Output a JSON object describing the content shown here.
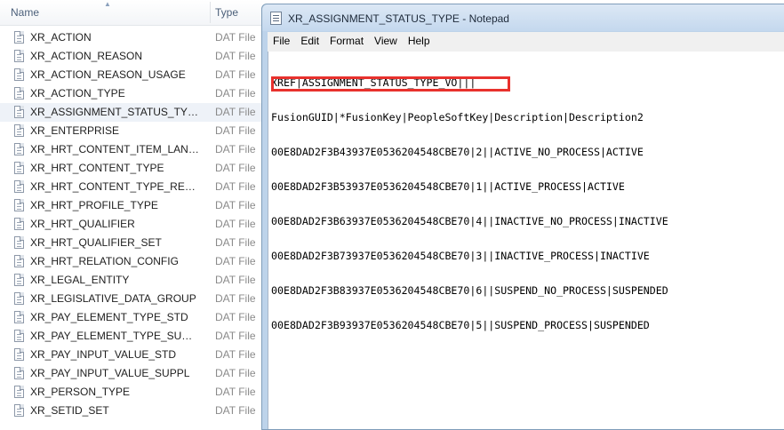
{
  "explorer": {
    "columns": {
      "name": "Name",
      "type": "Type"
    },
    "files": [
      {
        "name": "XR_ACTION",
        "type": "DAT File"
      },
      {
        "name": "XR_ACTION_REASON",
        "type": "DAT File"
      },
      {
        "name": "XR_ACTION_REASON_USAGE",
        "type": "DAT File"
      },
      {
        "name": "XR_ACTION_TYPE",
        "type": "DAT File"
      },
      {
        "name": "XR_ASSIGNMENT_STATUS_TYPE",
        "type": "DAT File",
        "selected": true
      },
      {
        "name": "XR_ENTERPRISE",
        "type": "DAT File"
      },
      {
        "name": "XR_HRT_CONTENT_ITEM_LANGU...",
        "type": "DAT File"
      },
      {
        "name": "XR_HRT_CONTENT_TYPE",
        "type": "DAT File"
      },
      {
        "name": "XR_HRT_CONTENT_TYPE_RELAT",
        "type": "DAT File"
      },
      {
        "name": "XR_HRT_PROFILE_TYPE",
        "type": "DAT File"
      },
      {
        "name": "XR_HRT_QUALIFIER",
        "type": "DAT File"
      },
      {
        "name": "XR_HRT_QUALIFIER_SET",
        "type": "DAT File"
      },
      {
        "name": "XR_HRT_RELATION_CONFIG",
        "type": "DAT File"
      },
      {
        "name": "XR_LEGAL_ENTITY",
        "type": "DAT File"
      },
      {
        "name": "XR_LEGISLATIVE_DATA_GROUP",
        "type": "DAT File"
      },
      {
        "name": "XR_PAY_ELEMENT_TYPE_STD",
        "type": "DAT File"
      },
      {
        "name": "XR_PAY_ELEMENT_TYPE_SUPPL",
        "type": "DAT File"
      },
      {
        "name": "XR_PAY_INPUT_VALUE_STD",
        "type": "DAT File"
      },
      {
        "name": "XR_PAY_INPUT_VALUE_SUPPL",
        "type": "DAT File"
      },
      {
        "name": "XR_PERSON_TYPE",
        "type": "DAT File"
      },
      {
        "name": "XR_SETID_SET",
        "type": "DAT File"
      }
    ]
  },
  "notepad": {
    "title": "XR_ASSIGNMENT_STATUS_TYPE - Notepad",
    "menu": [
      "File",
      "Edit",
      "Format",
      "View",
      "Help"
    ],
    "lines": [
      "XREF|ASSIGNMENT_STATUS_TYPE_VO|||",
      "FusionGUID|*FusionKey|PeopleSoftKey|Description|Description2",
      "00E8DAD2F3B43937E0536204548CBE70|2||ACTIVE_NO_PROCESS|ACTIVE",
      "00E8DAD2F3B53937E0536204548CBE70|1||ACTIVE_PROCESS|ACTIVE",
      "00E8DAD2F3B63937E0536204548CBE70|4||INACTIVE_NO_PROCESS|INACTIVE",
      "00E8DAD2F3B73937E0536204548CBE70|3||INACTIVE_PROCESS|INACTIVE",
      "00E8DAD2F3B83937E0536204548CBE70|6||SUSPEND_NO_PROCESS|SUSPENDED",
      "00E8DAD2F3B93937E0536204548CBE70|5||SUSPEND_PROCESS|SUSPENDED"
    ],
    "highlight_color": "#e8312d"
  },
  "icons": {
    "file": "document-icon",
    "notepad": "notepad-icon",
    "sort": "sort-ascending-icon"
  }
}
